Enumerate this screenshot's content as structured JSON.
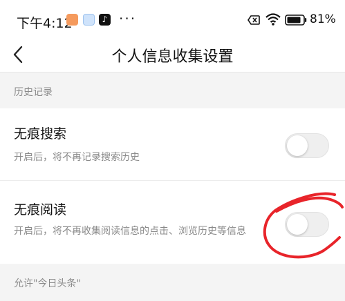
{
  "status_bar": {
    "time": "下午4:12",
    "tiktok_glyph": "♪",
    "more": "···",
    "battery": "81%",
    "icons": [
      "orange-app-icon",
      "blue-app-icon",
      "tiktok-icon",
      "sim-off-icon",
      "wifi-icon",
      "battery-icon"
    ]
  },
  "nav": {
    "title": "个人信息收集设置",
    "back_icon": "chevron-left-icon"
  },
  "sections": [
    {
      "header": "历史记录",
      "items": [
        {
          "title": "无痕搜索",
          "description": "开启后，将不再记录搜索历史",
          "enabled": false
        },
        {
          "title": "无痕阅读",
          "description": "开启后，将不再收集阅读信息的点击、浏览历史等信息",
          "enabled": false
        }
      ]
    },
    {
      "header": "允许\"今日头条\""
    }
  ],
  "colors": {
    "annotation_red": "#e8242a",
    "toggle_off": "#efefef",
    "section_text": "#8a8a8a"
  }
}
